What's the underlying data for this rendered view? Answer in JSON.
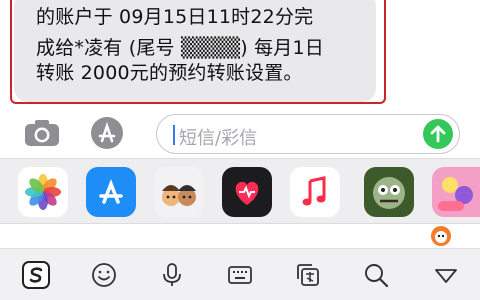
{
  "message": {
    "lines": [
      "的账户于 09月15日11时22分完",
      "成给*凌有 (尾号 ▒▒▒▒) 每月1日",
      "转账 2000元的预约转账设置。"
    ]
  },
  "input": {
    "placeholder": "短信/彩信"
  },
  "apps": [
    {
      "name": "Photos"
    },
    {
      "name": "App Store"
    },
    {
      "name": "Memoji"
    },
    {
      "name": "Digital Touch"
    },
    {
      "name": "Music"
    },
    {
      "name": "Plants vs Zombies"
    },
    {
      "name": "Candy game"
    }
  ],
  "colors": {
    "highlight": "#c8262c",
    "send": "#34c759",
    "bubble": "#e9e9eb",
    "caret": "#3478f6"
  }
}
